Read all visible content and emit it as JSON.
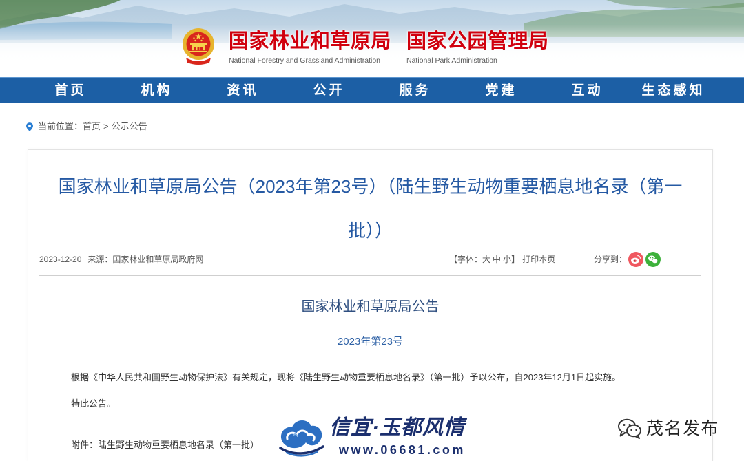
{
  "header": {
    "name_forestry_cn": "国家林业和草原局",
    "name_forestry_en": "National Forestry and Grassland Administration",
    "name_park_cn": "国家公园管理局",
    "name_park_en": "National Park Administration"
  },
  "nav": {
    "items": [
      "首页",
      "机构",
      "资讯",
      "公开",
      "服务",
      "党建",
      "互动",
      "生态感知"
    ]
  },
  "breadcrumb": {
    "prefix": "当前位置：",
    "home": "首页",
    "separator": ">",
    "current": "公示公告"
  },
  "article": {
    "title": "国家林业和草原局公告（2023年第23号）（陆生野生动物重要栖息地名录（第一批））",
    "date": "2023-12-20",
    "source_label": "来源：",
    "source": "国家林业和草原局政府网",
    "font_size_open": "【字体：",
    "font_size_options": [
      "大",
      "中",
      "小"
    ],
    "font_size_close": "】",
    "print": "打印本页",
    "share_label": "分享到：",
    "heading": "国家林业和草原局公告",
    "issue_number": "2023年第23号",
    "body": "根据《中华人民共和国野生动物保护法》有关规定，现将《陆生野生动物重要栖息地名录》（第一批）予以公布，自2023年12月1日起实施。",
    "closing": "特此公告。",
    "attachment_label": "附件：",
    "attachment_name": "陆生野生动物重要栖息地名录（第一批）"
  },
  "watermarks": {
    "xinyi_title": "信宜·玉都风情",
    "xinyi_url": "www.06681.com",
    "maoming_label": "茂名发布"
  },
  "icons": {
    "emblem": "national-emblem-icon",
    "location": "location-pin-icon",
    "share_weibo": "weibo-icon",
    "share_wechat": "wechat-icon",
    "xinyi_logo": "cloud-logo-icon",
    "maoming_logo": "wechat-official-account-icon"
  },
  "colors": {
    "brand_red": "#d0000e",
    "nav_bg": "#1c5fa5",
    "title_blue": "#2559a3",
    "heading_blue": "#2f4f80",
    "number_blue": "#2f62a6",
    "weibo": "#f0575f",
    "wechat": "#3db13b",
    "watermark_navy": "#1b2f6e"
  }
}
